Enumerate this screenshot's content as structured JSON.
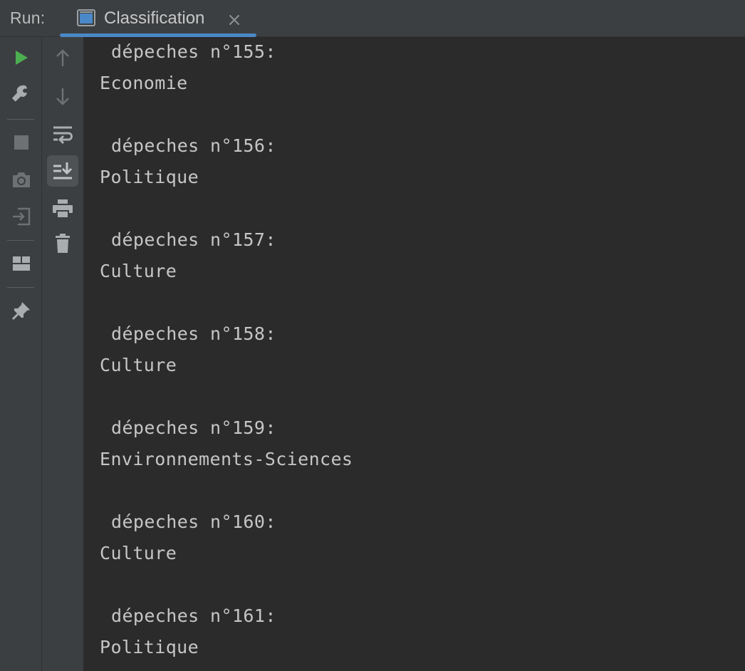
{
  "header": {
    "run_label": "Run:",
    "tab_title": "Classification",
    "close_icon": "close-icon",
    "tab_icon": "console-window-icon"
  },
  "left_toolbar": {
    "items": [
      {
        "icon": "run-icon"
      },
      {
        "icon": "wrench-icon"
      },
      {
        "icon": "stop-icon"
      },
      {
        "icon": "camera-icon"
      },
      {
        "icon": "import-icon"
      },
      {
        "icon": "layout-icon"
      },
      {
        "icon": "pin-icon"
      }
    ]
  },
  "second_toolbar": {
    "items": [
      {
        "icon": "arrow-up-icon"
      },
      {
        "icon": "arrow-down-icon"
      },
      {
        "icon": "soft-wrap-icon"
      },
      {
        "icon": "scroll-to-end-icon"
      },
      {
        "icon": "print-icon"
      },
      {
        "icon": "trash-icon"
      }
    ]
  },
  "console": {
    "entries": [
      {
        "header": "dépeches n°155:",
        "value": "Economie"
      },
      {
        "header": "dépeches n°156:",
        "value": "Politique"
      },
      {
        "header": "dépeches n°157:",
        "value": "Culture"
      },
      {
        "header": "dépeches n°158:",
        "value": "Culture"
      },
      {
        "header": "dépeches n°159:",
        "value": "Environnements-Sciences"
      },
      {
        "header": "dépeches n°160:",
        "value": "Culture"
      },
      {
        "header": "dépeches n°161:",
        "value": "Politique"
      }
    ]
  },
  "colors": {
    "run_green": "#4caf50",
    "accent_blue": "#4a88c7",
    "toolbar_bg": "#3c3f41",
    "console_bg": "#2b2b2b",
    "icon_gray": "#a9adb0"
  }
}
